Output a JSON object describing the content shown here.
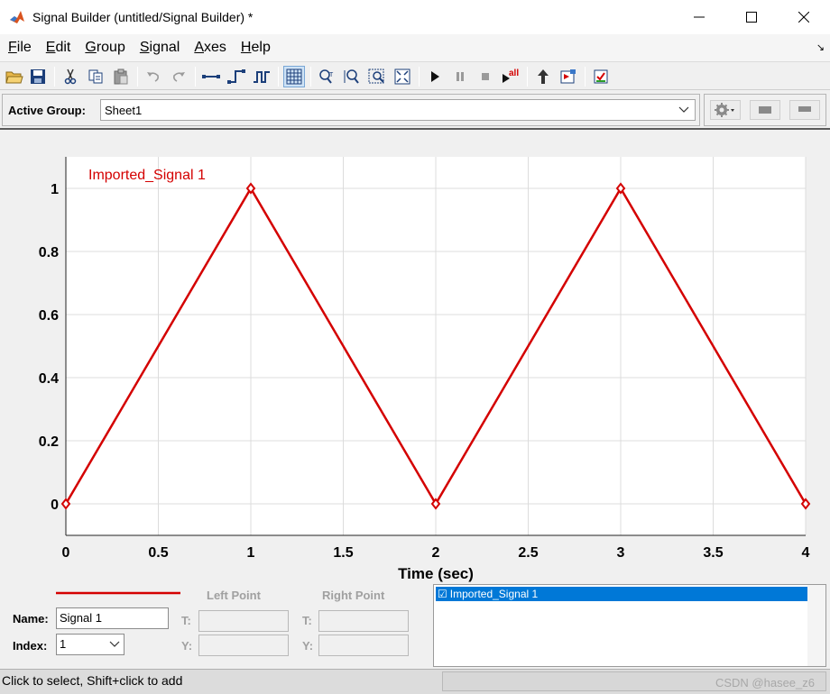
{
  "window": {
    "title": "Signal Builder (untitled/Signal Builder) *"
  },
  "menu": [
    {
      "label": "File",
      "accel": "F",
      "rest": "ile"
    },
    {
      "label": "Edit",
      "accel": "E",
      "rest": "dit"
    },
    {
      "label": "Group",
      "accel": "G",
      "rest": "roup"
    },
    {
      "label": "Signal",
      "accel": "S",
      "rest": "ignal"
    },
    {
      "label": "Axes",
      "accel": "A",
      "rest": "xes"
    },
    {
      "label": "Help",
      "accel": "H",
      "rest": "elp"
    }
  ],
  "group": {
    "label": "Active Group:",
    "value": "Sheet1"
  },
  "chart_data": {
    "type": "line",
    "title": "",
    "xlabel": "Time (sec)",
    "ylabel": "",
    "xlim": [
      0,
      4
    ],
    "ylim": [
      -0.1,
      1.1
    ],
    "xticks": [
      0,
      0.5,
      1,
      1.5,
      2,
      2.5,
      3,
      3.5,
      4
    ],
    "xtick_labels": [
      "0",
      "0.5",
      "1",
      "1.5",
      "2",
      "2.5",
      "3",
      "3.5",
      "4"
    ],
    "yticks": [
      0,
      0.2,
      0.4,
      0.6,
      0.8,
      1
    ],
    "ytick_labels": [
      "0",
      "0.2",
      "0.4",
      "0.6",
      "0.8",
      "1"
    ],
    "grid": true,
    "series": [
      {
        "name": "Imported_Signal 1",
        "color": "#d40000",
        "x": [
          0,
          1,
          2,
          3,
          4
        ],
        "y": [
          0,
          1,
          0,
          1,
          0
        ],
        "marker": "diamond"
      }
    ]
  },
  "signal_props": {
    "name_label": "Name:",
    "name_value": "Signal 1",
    "index_label": "Index:",
    "index_value": "1",
    "left_point_label": "Left Point",
    "right_point_label": "Right Point",
    "t_label": "T:",
    "y_label": "Y:",
    "line_color": "#d40000"
  },
  "signal_list": {
    "items": [
      {
        "checked": true,
        "check_glyph": "☑",
        "label": "Imported_Signal 1"
      }
    ]
  },
  "status": {
    "message": "Click to select, Shift+click to add",
    "watermark": "CSDN @hasee_z6"
  }
}
